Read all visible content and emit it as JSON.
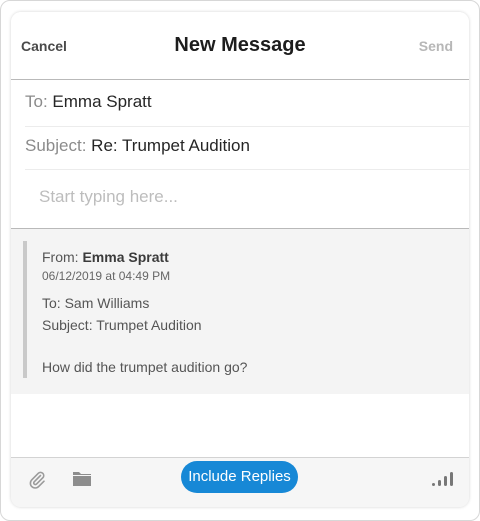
{
  "header": {
    "cancel_label": "Cancel",
    "title": "New Message",
    "send_label": "Send"
  },
  "fields": {
    "to_label": "To:",
    "to_value": "Emma Spratt",
    "subject_label": "Subject:",
    "subject_value": "Re: Trumpet Audition",
    "body_placeholder": "Start typing here..."
  },
  "quoted": {
    "from_label": "From:",
    "from_name": "Emma Spratt",
    "date": "06/12/2019 at 04:49 PM",
    "to_line": "To: Sam Williams",
    "subject_line": "Subject: Trumpet Audition",
    "body": "How did the trumpet audition go?"
  },
  "toolbar": {
    "include_replies_label": "Include Replies",
    "icons": [
      "paperclip-icon",
      "folder-icon",
      "signal-icon"
    ]
  },
  "colors": {
    "accent": "#1788d6",
    "send_disabled": "#b7b7b7",
    "quoted_bg": "#f4f4f4"
  }
}
